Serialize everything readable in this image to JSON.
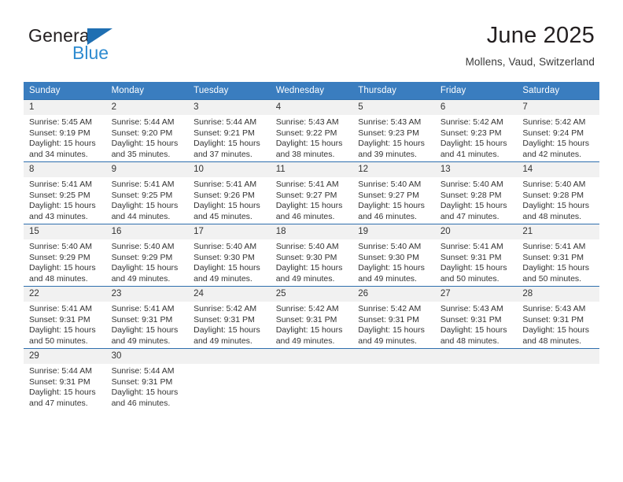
{
  "brand": {
    "name_top": "General",
    "name_bottom": "Blue",
    "accent_color": "#1f6fb2",
    "accent_color_light": "#2e8bd0"
  },
  "header": {
    "title": "June 2025",
    "subtitle": "Mollens, Vaud, Switzerland"
  },
  "calendar": {
    "header_bg": "#3a7dbf",
    "header_text_color": "#ffffff",
    "daynum_bg": "#f1f1f1",
    "weekdays": [
      "Sunday",
      "Monday",
      "Tuesday",
      "Wednesday",
      "Thursday",
      "Friday",
      "Saturday"
    ],
    "weeks": [
      [
        {
          "day": "",
          "lines": []
        },
        {
          "day": "",
          "lines": []
        },
        {
          "day": "",
          "lines": []
        },
        {
          "day": "",
          "lines": []
        },
        {
          "day": "",
          "lines": []
        },
        {
          "day": "",
          "lines": []
        },
        {
          "day": "",
          "lines": []
        }
      ],
      [
        {
          "day": "1",
          "lines": [
            "Sunrise: 5:45 AM",
            "Sunset: 9:19 PM",
            "Daylight: 15 hours",
            "and 34 minutes."
          ]
        },
        {
          "day": "2",
          "lines": [
            "Sunrise: 5:44 AM",
            "Sunset: 9:20 PM",
            "Daylight: 15 hours",
            "and 35 minutes."
          ]
        },
        {
          "day": "3",
          "lines": [
            "Sunrise: 5:44 AM",
            "Sunset: 9:21 PM",
            "Daylight: 15 hours",
            "and 37 minutes."
          ]
        },
        {
          "day": "4",
          "lines": [
            "Sunrise: 5:43 AM",
            "Sunset: 9:22 PM",
            "Daylight: 15 hours",
            "and 38 minutes."
          ]
        },
        {
          "day": "5",
          "lines": [
            "Sunrise: 5:43 AM",
            "Sunset: 9:23 PM",
            "Daylight: 15 hours",
            "and 39 minutes."
          ]
        },
        {
          "day": "6",
          "lines": [
            "Sunrise: 5:42 AM",
            "Sunset: 9:23 PM",
            "Daylight: 15 hours",
            "and 41 minutes."
          ]
        },
        {
          "day": "7",
          "lines": [
            "Sunrise: 5:42 AM",
            "Sunset: 9:24 PM",
            "Daylight: 15 hours",
            "and 42 minutes."
          ]
        }
      ],
      [
        {
          "day": "8",
          "lines": [
            "Sunrise: 5:41 AM",
            "Sunset: 9:25 PM",
            "Daylight: 15 hours",
            "and 43 minutes."
          ]
        },
        {
          "day": "9",
          "lines": [
            "Sunrise: 5:41 AM",
            "Sunset: 9:25 PM",
            "Daylight: 15 hours",
            "and 44 minutes."
          ]
        },
        {
          "day": "10",
          "lines": [
            "Sunrise: 5:41 AM",
            "Sunset: 9:26 PM",
            "Daylight: 15 hours",
            "and 45 minutes."
          ]
        },
        {
          "day": "11",
          "lines": [
            "Sunrise: 5:41 AM",
            "Sunset: 9:27 PM",
            "Daylight: 15 hours",
            "and 46 minutes."
          ]
        },
        {
          "day": "12",
          "lines": [
            "Sunrise: 5:40 AM",
            "Sunset: 9:27 PM",
            "Daylight: 15 hours",
            "and 46 minutes."
          ]
        },
        {
          "day": "13",
          "lines": [
            "Sunrise: 5:40 AM",
            "Sunset: 9:28 PM",
            "Daylight: 15 hours",
            "and 47 minutes."
          ]
        },
        {
          "day": "14",
          "lines": [
            "Sunrise: 5:40 AM",
            "Sunset: 9:28 PM",
            "Daylight: 15 hours",
            "and 48 minutes."
          ]
        }
      ],
      [
        {
          "day": "15",
          "lines": [
            "Sunrise: 5:40 AM",
            "Sunset: 9:29 PM",
            "Daylight: 15 hours",
            "and 48 minutes."
          ]
        },
        {
          "day": "16",
          "lines": [
            "Sunrise: 5:40 AM",
            "Sunset: 9:29 PM",
            "Daylight: 15 hours",
            "and 49 minutes."
          ]
        },
        {
          "day": "17",
          "lines": [
            "Sunrise: 5:40 AM",
            "Sunset: 9:30 PM",
            "Daylight: 15 hours",
            "and 49 minutes."
          ]
        },
        {
          "day": "18",
          "lines": [
            "Sunrise: 5:40 AM",
            "Sunset: 9:30 PM",
            "Daylight: 15 hours",
            "and 49 minutes."
          ]
        },
        {
          "day": "19",
          "lines": [
            "Sunrise: 5:40 AM",
            "Sunset: 9:30 PM",
            "Daylight: 15 hours",
            "and 49 minutes."
          ]
        },
        {
          "day": "20",
          "lines": [
            "Sunrise: 5:41 AM",
            "Sunset: 9:31 PM",
            "Daylight: 15 hours",
            "and 50 minutes."
          ]
        },
        {
          "day": "21",
          "lines": [
            "Sunrise: 5:41 AM",
            "Sunset: 9:31 PM",
            "Daylight: 15 hours",
            "and 50 minutes."
          ]
        }
      ],
      [
        {
          "day": "22",
          "lines": [
            "Sunrise: 5:41 AM",
            "Sunset: 9:31 PM",
            "Daylight: 15 hours",
            "and 50 minutes."
          ]
        },
        {
          "day": "23",
          "lines": [
            "Sunrise: 5:41 AM",
            "Sunset: 9:31 PM",
            "Daylight: 15 hours",
            "and 49 minutes."
          ]
        },
        {
          "day": "24",
          "lines": [
            "Sunrise: 5:42 AM",
            "Sunset: 9:31 PM",
            "Daylight: 15 hours",
            "and 49 minutes."
          ]
        },
        {
          "day": "25",
          "lines": [
            "Sunrise: 5:42 AM",
            "Sunset: 9:31 PM",
            "Daylight: 15 hours",
            "and 49 minutes."
          ]
        },
        {
          "day": "26",
          "lines": [
            "Sunrise: 5:42 AM",
            "Sunset: 9:31 PM",
            "Daylight: 15 hours",
            "and 49 minutes."
          ]
        },
        {
          "day": "27",
          "lines": [
            "Sunrise: 5:43 AM",
            "Sunset: 9:31 PM",
            "Daylight: 15 hours",
            "and 48 minutes."
          ]
        },
        {
          "day": "28",
          "lines": [
            "Sunrise: 5:43 AM",
            "Sunset: 9:31 PM",
            "Daylight: 15 hours",
            "and 48 minutes."
          ]
        }
      ],
      [
        {
          "day": "29",
          "lines": [
            "Sunrise: 5:44 AM",
            "Sunset: 9:31 PM",
            "Daylight: 15 hours",
            "and 47 minutes."
          ]
        },
        {
          "day": "30",
          "lines": [
            "Sunrise: 5:44 AM",
            "Sunset: 9:31 PM",
            "Daylight: 15 hours",
            "and 46 minutes."
          ]
        },
        {
          "day": "",
          "lines": []
        },
        {
          "day": "",
          "lines": []
        },
        {
          "day": "",
          "lines": []
        },
        {
          "day": "",
          "lines": []
        },
        {
          "day": "",
          "lines": []
        }
      ]
    ]
  }
}
